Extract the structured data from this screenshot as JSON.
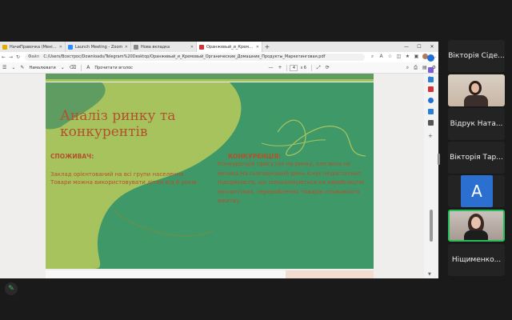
{
  "browser": {
    "tabs": [
      {
        "label": "НачиПравочка (Мені 4 з'являєтся)",
        "color": "#e0b000",
        "active": false
      },
      {
        "label": "Launch Meeting - Zoom",
        "color": "#2d8cff",
        "active": false
      },
      {
        "label": "Нова вкладка",
        "color": "#888888",
        "active": false
      },
      {
        "label": "Оранжевый_и_Кремовый_Органи...",
        "color": "#d13438",
        "active": true
      }
    ],
    "new_tab": "+",
    "window_controls": [
      "—",
      "☐",
      "✕"
    ],
    "address": {
      "file_label": "Файл",
      "url": "C:/Users/Всестрос/Downloads/Telegram%20Desktop/Оранжевый_и_Кремовый_Органические_Домашние_Продукты_Маркетинговая.pdf"
    },
    "pdf_toolbar": {
      "draw_label": "Намалювати",
      "erase_label": "Прочитати вголос",
      "zoom_minus": "—",
      "zoom_plus": "+",
      "page_current": "4",
      "page_total": "з 6"
    }
  },
  "slide": {
    "title": "Аналіз ринку та конкурентів",
    "left_heading": "СПОЖИВАЧ:",
    "left_body": "Заклад орієнтований на всі групи населення. Товари можна використовувати дітям від 6 років",
    "right_heading": "КОНКУРЕНЦІЯ:",
    "right_body": "Конкуренція присутня на ринку, але вона не велика.На сьогоднішній день існує недостатньо підприємств, що спеціалізуються на виробництві екологічних, перероблених товарів споживчого вжитку."
  },
  "participants": [
    {
      "name": "Вікторія Сіде..."
    },
    {
      "name": ""
    },
    {
      "name": "Відрук Ната..."
    },
    {
      "name": "Вікторія Тар..."
    },
    {
      "name": "A"
    },
    {
      "name": ""
    },
    {
      "name": "Ніщименко..."
    }
  ]
}
